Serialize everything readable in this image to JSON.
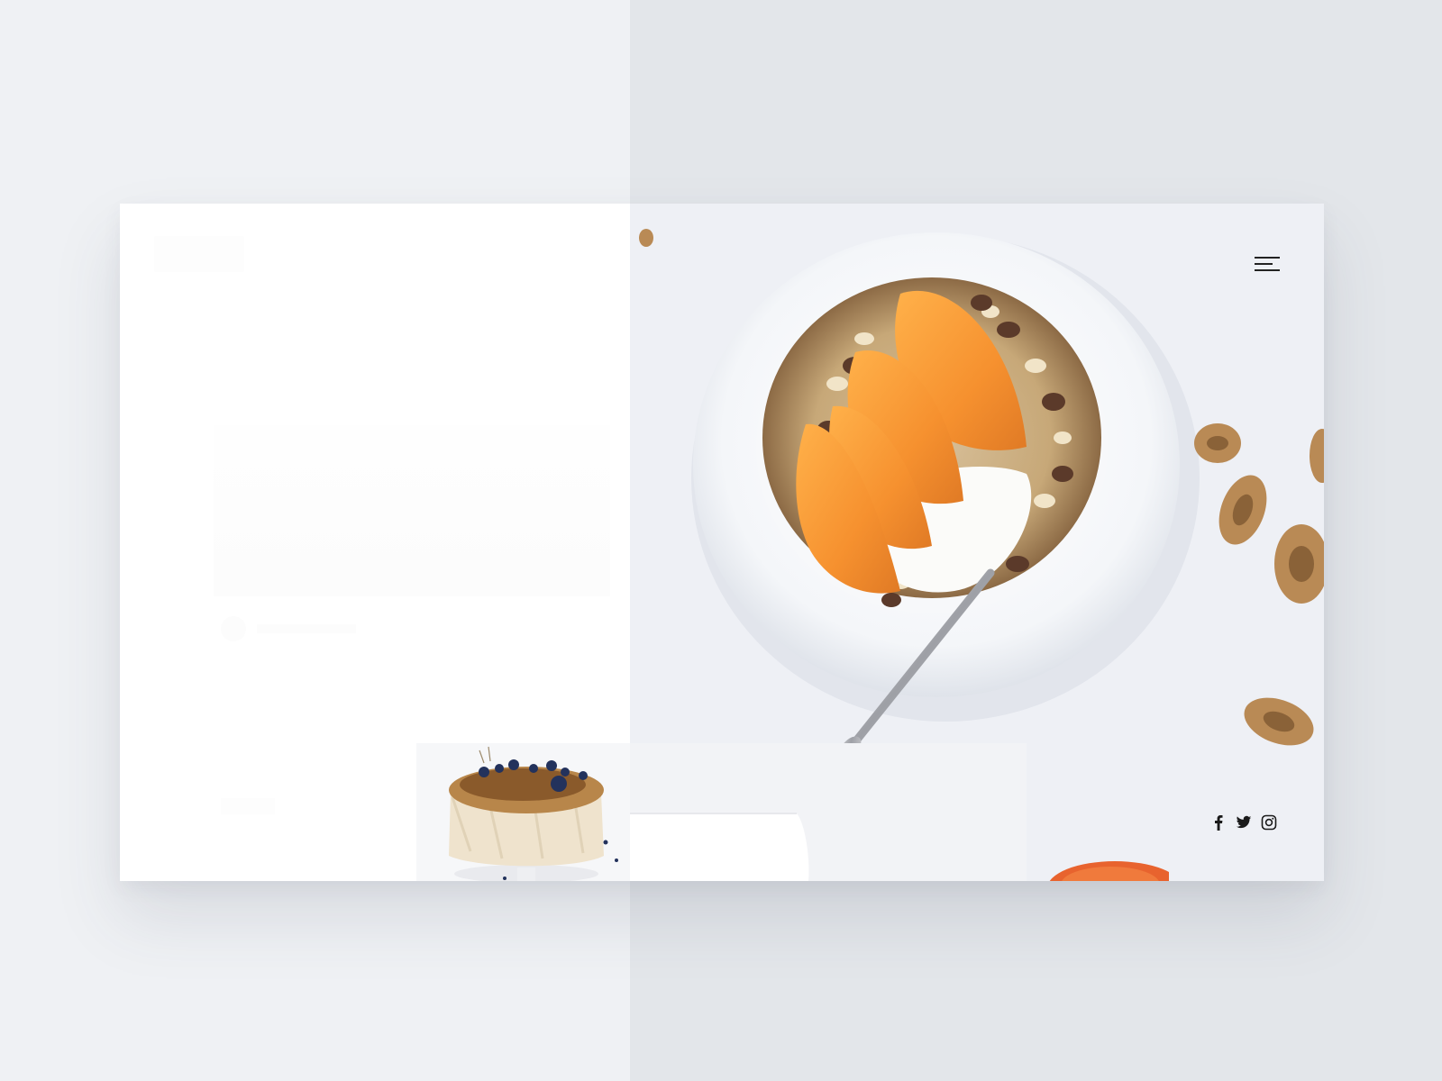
{
  "page": {
    "background_left": "#eff1f4",
    "background_right": "#e3e6ea",
    "card_color": "#ffffff",
    "accent": "#f28c28"
  },
  "header": {
    "menu_icon": "hamburger-menu-icon"
  },
  "hero": {
    "image": "granola-bowl-with-persimmon-slices-photo"
  },
  "gallery": {
    "items": [
      {
        "name": "cake-with-blueberries-photo"
      },
      {
        "name": "white-napkin-photo"
      },
      {
        "name": "orange-fruit-photo"
      }
    ]
  },
  "social": {
    "links": [
      {
        "icon": "facebook-icon"
      },
      {
        "icon": "twitter-icon"
      },
      {
        "icon": "instagram-icon"
      }
    ]
  }
}
